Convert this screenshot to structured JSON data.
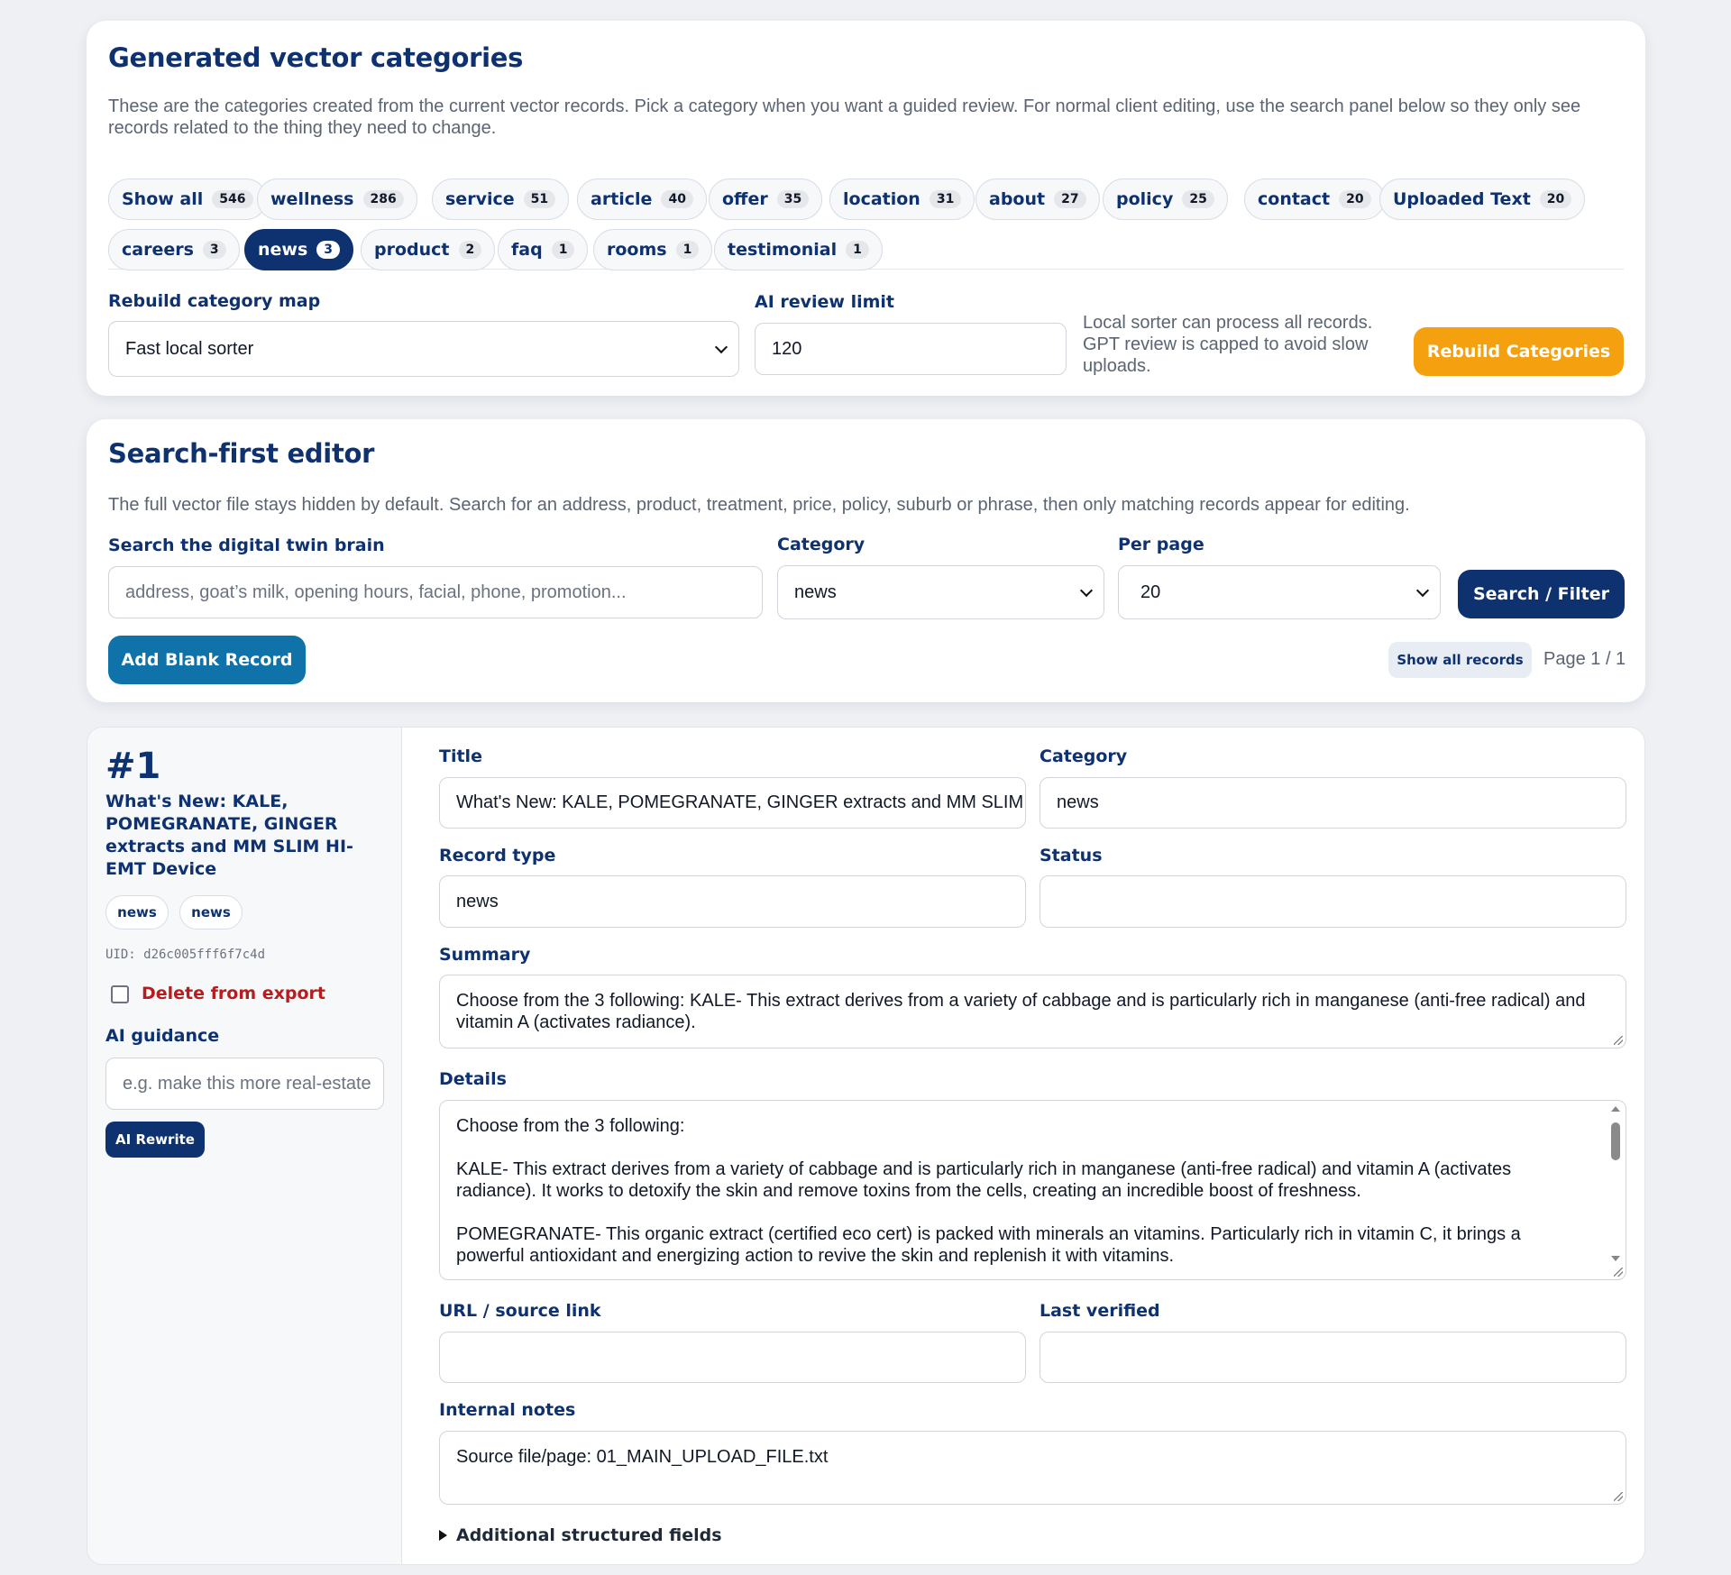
{
  "categories_card": {
    "title": "Generated vector categories",
    "description": "These are the categories created from the current vector records. Pick a category when you want a guided review. For normal client editing, use the search panel below so they only see records related to the thing they need to change.",
    "pills": [
      {
        "label": "Show all",
        "count": "546"
      },
      {
        "label": "wellness",
        "count": "286"
      },
      {
        "label": "service",
        "count": "51"
      },
      {
        "label": "article",
        "count": "40"
      },
      {
        "label": "offer",
        "count": "35"
      },
      {
        "label": "location",
        "count": "31"
      },
      {
        "label": "about",
        "count": "27"
      },
      {
        "label": "policy",
        "count": "25"
      },
      {
        "label": "contact",
        "count": "20"
      },
      {
        "label": "Uploaded Text",
        "count": "20"
      },
      {
        "label": "careers",
        "count": "3"
      },
      {
        "label": "news",
        "count": "3"
      },
      {
        "label": "product",
        "count": "2"
      },
      {
        "label": "faq",
        "count": "1"
      },
      {
        "label": "rooms",
        "count": "1"
      },
      {
        "label": "testimonial",
        "count": "1"
      }
    ],
    "active_pill": "news",
    "rebuild_label": "Rebuild category map",
    "rebuild_value": "Fast local sorter",
    "ai_limit_label": "AI review limit",
    "ai_limit_value": "120",
    "note": "Local sorter can process all records. GPT review is capped to avoid slow uploads.",
    "rebuild_button": "Rebuild Categories"
  },
  "search_card": {
    "title": "Search-first editor",
    "description": "The full vector file stays hidden by default. Search for an address, product, treatment, price, policy, suburb or phrase, then only matching records appear for editing.",
    "search_label": "Search the digital twin brain",
    "search_placeholder": "address, goat’s milk, opening hours, facial, phone, promotion...",
    "category_label": "Category",
    "category_value": "news",
    "per_page_label": "Per page",
    "per_page_value": "20",
    "search_button": "Search / Filter",
    "add_button": "Add Blank Record",
    "show_all_button": "Show all records",
    "page_info": "Page 1 / 1"
  },
  "record": {
    "number": "#1",
    "title": "What's New: KALE, POMEGRANATE, GINGER extracts and MM SLIM HI-EMT Device",
    "tags": [
      "news",
      "news"
    ],
    "uid": "UID: d26c005fff6f7c4d",
    "delete_label": "Delete from export",
    "delete_checked": false,
    "ai_guidance_label": "AI guidance",
    "ai_guidance_placeholder": "e.g. make this more real-estate",
    "ai_rewrite_button": "AI Rewrite",
    "fields": {
      "title_label": "Title",
      "title_value": "What's New: KALE, POMEGRANATE, GINGER extracts and MM SLIM HI-EMT Device",
      "category_label": "Category",
      "category_value": "news",
      "record_type_label": "Record type",
      "record_type_value": "news",
      "status_label": "Status",
      "status_value": "",
      "summary_label": "Summary",
      "summary_value": "Choose from the 3 following: KALE- This extract derives from a variety of cabbage and is particularly rich in manganese (anti-free radical) and vitamin A (activates radiance).",
      "details_label": "Details",
      "details_paragraphs": [
        "Choose from the 3 following:",
        "KALE- This extract derives from a variety of cabbage and is particularly rich in manganese (anti-free radical) and vitamin A (activates radiance). It works to detoxify the skin and remove toxins from the cells, creating an incredible boost of freshness.",
        "POMEGRANATE- This organic extract (certified eco cert) is packed with minerals an vitamins. Particularly rich in vitamin C, it brings a powerful antioxidant and energizing action to revive the skin and replenish it with vitamins."
      ],
      "url_label": "URL / source link",
      "url_value": "",
      "verified_label": "Last verified",
      "verified_value": "",
      "notes_label": "Internal notes",
      "notes_value": "Source file/page: 01_MAIN_UPLOAD_FILE.txt",
      "additional_label": "Additional structured fields"
    }
  },
  "colors": {
    "navy": "#0e3170",
    "orange": "#f5a10f",
    "teal": "#0f72a8",
    "danger": "#b91c1c"
  }
}
